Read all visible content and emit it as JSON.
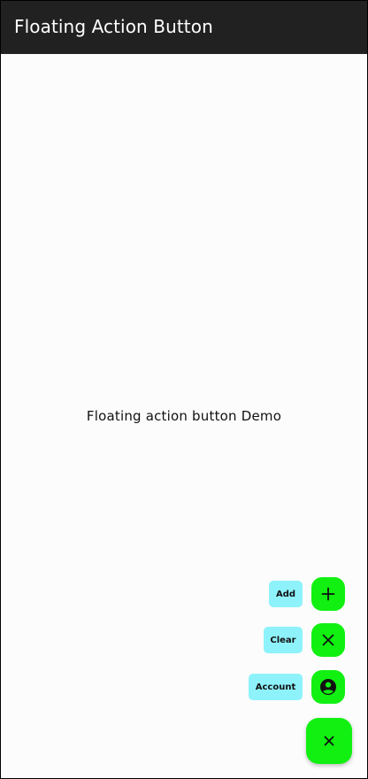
{
  "app_bar": {
    "title": "Floating Action Button"
  },
  "body": {
    "text": "Floating action button Demo"
  },
  "speed_dial": {
    "children": [
      {
        "label": "Add",
        "icon": "plus-icon"
      },
      {
        "label": "Clear",
        "icon": "close-icon"
      },
      {
        "label": "Account",
        "icon": "account-circle-icon"
      }
    ],
    "main_icon": "close-icon"
  },
  "colors": {
    "app_bar": "#212121",
    "fab": "#11f011",
    "label_bg": "#8ef2fb",
    "background": "#fcfcfc"
  }
}
